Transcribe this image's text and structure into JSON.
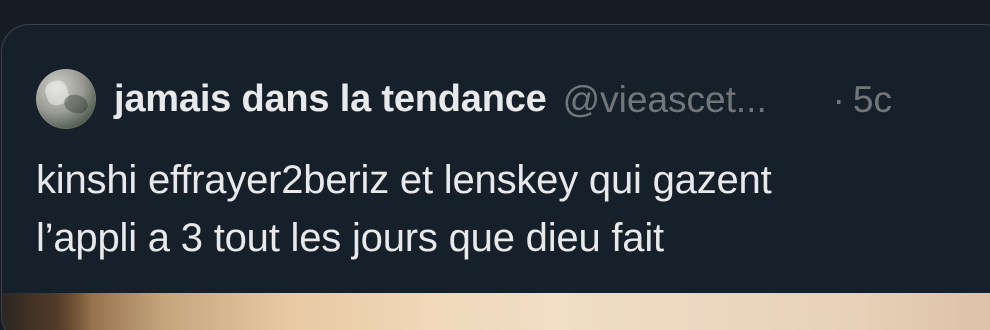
{
  "tweet": {
    "author": {
      "display_name": "jamais dans la tendance",
      "handle": "@vieascet...",
      "separator": "·",
      "time": "5c"
    },
    "text_lines": [
      "kinshi effrayer2beriz et lenskey qui gazent",
      "l’appli a 3 tout les jours que dieu fait"
    ]
  }
}
